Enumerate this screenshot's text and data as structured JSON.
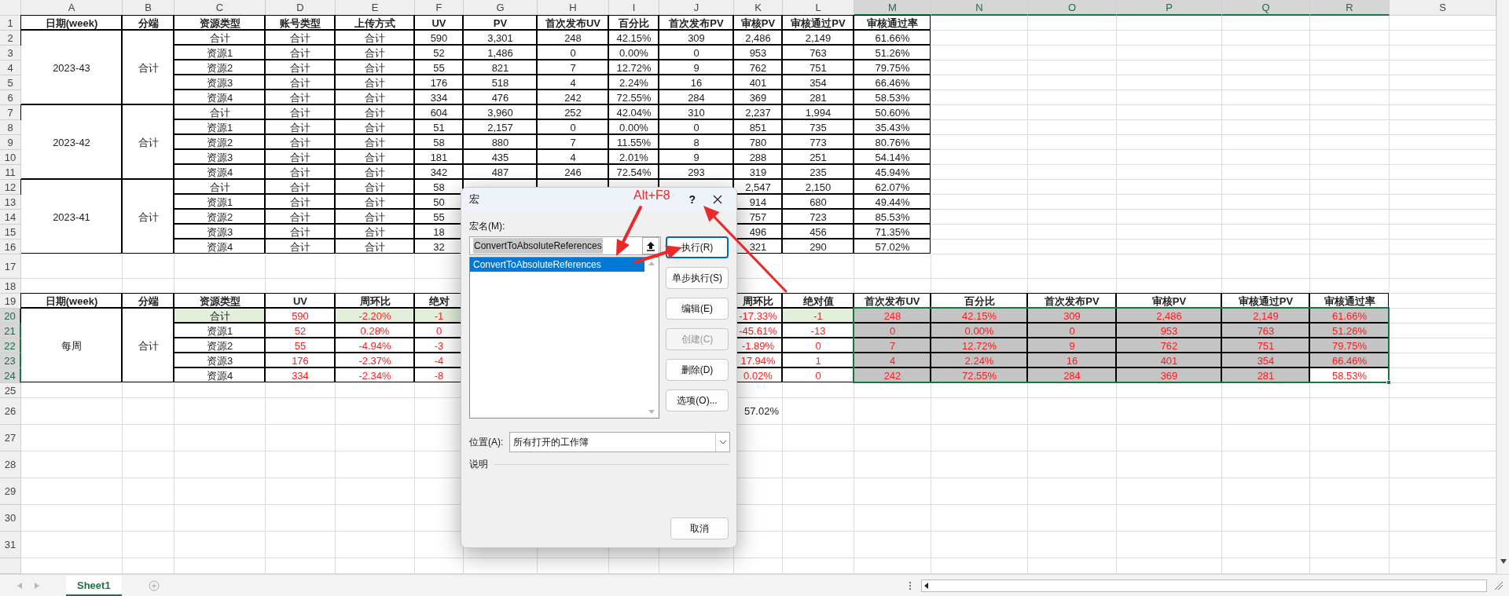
{
  "sheet": {
    "columns": [
      {
        "label": "A",
        "selected": false
      },
      {
        "label": "B",
        "selected": false
      },
      {
        "label": "C",
        "selected": false
      },
      {
        "label": "D",
        "selected": false
      },
      {
        "label": "E",
        "selected": false
      },
      {
        "label": "F",
        "selected": false
      },
      {
        "label": "G",
        "selected": false
      },
      {
        "label": "H",
        "selected": false
      },
      {
        "label": "I",
        "selected": false
      },
      {
        "label": "J",
        "selected": false
      },
      {
        "label": "K",
        "selected": false
      },
      {
        "label": "L",
        "selected": false
      },
      {
        "label": "M",
        "selected": true
      },
      {
        "label": "N",
        "selected": true
      },
      {
        "label": "O",
        "selected": true
      },
      {
        "label": "P",
        "selected": true
      },
      {
        "label": "Q",
        "selected": true
      },
      {
        "label": "R",
        "selected": true
      },
      {
        "label": "S",
        "selected": false
      }
    ],
    "rows": [
      {
        "label": "1",
        "selected": false
      },
      {
        "label": "2",
        "selected": false
      },
      {
        "label": "3",
        "selected": false
      },
      {
        "label": "4",
        "selected": false
      },
      {
        "label": "5",
        "selected": false
      },
      {
        "label": "6",
        "selected": false
      },
      {
        "label": "7",
        "selected": false
      },
      {
        "label": "8",
        "selected": false
      },
      {
        "label": "9",
        "selected": false
      },
      {
        "label": "10",
        "selected": false
      },
      {
        "label": "11",
        "selected": false
      },
      {
        "label": "12",
        "selected": false
      },
      {
        "label": "13",
        "selected": false
      },
      {
        "label": "14",
        "selected": false
      },
      {
        "label": "15",
        "selected": false
      },
      {
        "label": "16",
        "selected": false
      },
      {
        "label": "17",
        "selected": false
      },
      {
        "label": "18",
        "selected": false
      },
      {
        "label": "19",
        "selected": false
      },
      {
        "label": "20",
        "selected": true
      },
      {
        "label": "21",
        "selected": true
      },
      {
        "label": "22",
        "selected": true
      },
      {
        "label": "23",
        "selected": true
      },
      {
        "label": "24",
        "selected": true
      },
      {
        "label": "25",
        "selected": false
      },
      {
        "label": "26",
        "selected": false,
        "cells_after_dialog": [
          "57.02%"
        ]
      },
      {
        "label": "27",
        "selected": false
      },
      {
        "label": "28",
        "selected": false
      },
      {
        "label": "29",
        "selected": false
      },
      {
        "label": "30",
        "selected": false
      },
      {
        "label": "31",
        "selected": false
      }
    ],
    "top_table": {
      "header": [
        "日期(week)",
        "分端",
        "资源类型",
        "账号类型",
        "上传方式",
        "UV",
        "PV",
        "首次发布UV",
        "百分比",
        "首次发布PV",
        "审核PV",
        "审核通过PV",
        "审核通过率"
      ],
      "groups": [
        {
          "kind": "plain",
          "week": "2023-43",
          "platform": "合计",
          "rows": [
            {
              "cells": [
                "合计",
                "合计",
                "合计",
                "590",
                "3,301",
                "248",
                "42.15%",
                "309",
                "2,486",
                "2,149",
                "61.66%"
              ]
            },
            {
              "cells": [
                "资源1",
                "合计",
                "合计",
                "52",
                "1,486",
                "0",
                "0.00%",
                "0",
                "953",
                "763",
                "51.26%"
              ]
            },
            {
              "cells": [
                "资源2",
                "合计",
                "合计",
                "55",
                "821",
                "7",
                "12.72%",
                "9",
                "762",
                "751",
                "79.75%"
              ]
            },
            {
              "cells": [
                "资源3",
                "合计",
                "合计",
                "176",
                "518",
                "4",
                "2.24%",
                "16",
                "401",
                "354",
                "66.46%"
              ]
            },
            {
              "cells": [
                "资源4",
                "合计",
                "合计",
                "334",
                "476",
                "242",
                "72.55%",
                "284",
                "369",
                "281",
                "58.53%"
              ]
            }
          ]
        },
        {
          "kind": "plain",
          "week": "2023-42",
          "platform": "合计",
          "rows": [
            {
              "cells": [
                "合计",
                "合计",
                "合计",
                "604",
                "3,960",
                "252",
                "42.04%",
                "310",
                "2,237",
                "1,994",
                "50.60%"
              ]
            },
            {
              "cells": [
                "资源1",
                "合计",
                "合计",
                "51",
                "2,157",
                "0",
                "0.00%",
                "0",
                "851",
                "735",
                "35.43%"
              ]
            },
            {
              "cells": [
                "资源2",
                "合计",
                "合计",
                "58",
                "880",
                "7",
                "11.55%",
                "8",
                "780",
                "773",
                "80.76%"
              ]
            },
            {
              "cells": [
                "资源3",
                "合计",
                "合计",
                "181",
                "435",
                "4",
                "2.01%",
                "9",
                "288",
                "251",
                "54.14%"
              ]
            },
            {
              "cells": [
                "资源4",
                "合计",
                "合计",
                "342",
                "487",
                "246",
                "72.54%",
                "293",
                "319",
                "235",
                "45.94%"
              ]
            }
          ]
        },
        {
          "kind": "plain",
          "week": "2023-41",
          "platform": "合计",
          "rows": [
            {
              "cells": [
                "合计",
                "合计",
                "合计",
                "58"
              ],
              "cells_after_dialog": [
                "2,547",
                "2,150",
                "62.07%"
              ]
            },
            {
              "cells": [
                "资源1",
                "合计",
                "合计",
                "50"
              ],
              "cells_after_dialog": [
                "914",
                "680",
                "49.44%"
              ]
            },
            {
              "cells": [
                "资源2",
                "合计",
                "合计",
                "55"
              ],
              "cells_after_dialog": [
                "757",
                "723",
                "85.53%"
              ]
            },
            {
              "cells": [
                "资源3",
                "合计",
                "合计",
                "18"
              ],
              "cells_after_dialog": [
                "496",
                "456",
                "71.35%"
              ]
            },
            {
              "cells": [
                "资源4",
                "合计",
                "合计",
                "32"
              ],
              "cells_after_dialog": [
                "321",
                "290",
                "57.02%"
              ]
            }
          ]
        }
      ]
    },
    "bottom_table": {
      "header": [
        "日期(week)",
        "分端",
        "资源类型",
        "UV",
        "周环比",
        "绝对"
      ],
      "header_after_dialog": [
        "周环比",
        "绝对值",
        "首次发布UV",
        "百分比",
        "首次发布PV",
        "审核PV",
        "审核通过PV",
        "审核通过率"
      ],
      "groups": [
        {
          "kind": "summary",
          "week": "每周",
          "platform": "合计",
          "rows": [
            {
              "cells": [
                {
                  "text": "合计",
                  "highlighted": true,
                  "selected": false
                },
                {
                  "text": "590",
                  "highlighted": false,
                  "selected": false
                },
                {
                  "text": "-2.20%",
                  "highlighted": true,
                  "selected": false
                },
                {
                  "text": "-1",
                  "highlighted": true,
                  "selected": false
                }
              ],
              "cells_after_dialog": [
                {
                  "text": "-17.33%",
                  "highlighted": false,
                  "selected": false
                },
                {
                  "text": "-1",
                  "highlighted": true,
                  "selected": false
                },
                {
                  "text": "248",
                  "highlighted": false,
                  "selected": true
                },
                {
                  "text": "42.15%",
                  "highlighted": false,
                  "selected": true
                },
                {
                  "text": "309",
                  "highlighted": false,
                  "selected": true
                },
                {
                  "text": "2,486",
                  "highlighted": false,
                  "selected": true
                },
                {
                  "text": "2,149",
                  "highlighted": false,
                  "selected": true
                },
                {
                  "text": "61.66%",
                  "highlighted": false,
                  "selected": true
                }
              ]
            },
            {
              "cells": [
                {
                  "text": "资源1",
                  "highlighted": false,
                  "selected": false
                },
                {
                  "text": "52",
                  "highlighted": false,
                  "selected": false
                },
                {
                  "text": "0.28%",
                  "highlighted": false,
                  "selected": false
                },
                {
                  "text": "0",
                  "highlighted": false,
                  "selected": false
                }
              ],
              "cells_after_dialog": [
                {
                  "text": "-45.61%",
                  "highlighted": false,
                  "selected": false
                },
                {
                  "text": "-13",
                  "highlighted": false,
                  "selected": false
                },
                {
                  "text": "0",
                  "highlighted": false,
                  "selected": true
                },
                {
                  "text": "0.00%",
                  "highlighted": false,
                  "selected": true
                },
                {
                  "text": "0",
                  "highlighted": false,
                  "selected": true
                },
                {
                  "text": "953",
                  "highlighted": false,
                  "selected": true
                },
                {
                  "text": "763",
                  "highlighted": false,
                  "selected": true
                },
                {
                  "text": "51.26%",
                  "highlighted": false,
                  "selected": true
                }
              ]
            },
            {
              "cells": [
                {
                  "text": "资源2",
                  "highlighted": false,
                  "selected": false
                },
                {
                  "text": "55",
                  "highlighted": false,
                  "selected": false
                },
                {
                  "text": "-4.94%",
                  "highlighted": false,
                  "selected": false
                },
                {
                  "text": "-3",
                  "highlighted": false,
                  "selected": false
                }
              ],
              "cells_after_dialog": [
                {
                  "text": "-1.89%",
                  "highlighted": false,
                  "selected": false
                },
                {
                  "text": "0",
                  "highlighted": false,
                  "selected": false
                },
                {
                  "text": "7",
                  "highlighted": false,
                  "selected": true
                },
                {
                  "text": "12.72%",
                  "highlighted": false,
                  "selected": true
                },
                {
                  "text": "9",
                  "highlighted": false,
                  "selected": true
                },
                {
                  "text": "762",
                  "highlighted": false,
                  "selected": true
                },
                {
                  "text": "751",
                  "highlighted": false,
                  "selected": true
                },
                {
                  "text": "79.75%",
                  "highlighted": false,
                  "selected": true
                }
              ]
            },
            {
              "cells": [
                {
                  "text": "资源3",
                  "highlighted": false,
                  "selected": false
                },
                {
                  "text": "176",
                  "highlighted": false,
                  "selected": false
                },
                {
                  "text": "-2.37%",
                  "highlighted": false,
                  "selected": false
                },
                {
                  "text": "-4",
                  "highlighted": false,
                  "selected": false
                }
              ],
              "cells_after_dialog": [
                {
                  "text": "17.94%",
                  "highlighted": false,
                  "selected": false
                },
                {
                  "text": "1",
                  "highlighted": false,
                  "selected": false
                },
                {
                  "text": "4",
                  "highlighted": false,
                  "selected": true
                },
                {
                  "text": "2.24%",
                  "highlighted": false,
                  "selected": true
                },
                {
                  "text": "16",
                  "highlighted": false,
                  "selected": true
                },
                {
                  "text": "401",
                  "highlighted": false,
                  "selected": true
                },
                {
                  "text": "354",
                  "highlighted": false,
                  "selected": true
                },
                {
                  "text": "66.46%",
                  "highlighted": false,
                  "selected": true
                }
              ]
            },
            {
              "cells": [
                {
                  "text": "资源4",
                  "highlighted": false,
                  "selected": false
                },
                {
                  "text": "334",
                  "highlighted": false,
                  "selected": false
                },
                {
                  "text": "-2.34%",
                  "highlighted": false,
                  "selected": false
                },
                {
                  "text": "-8",
                  "highlighted": false,
                  "selected": false
                }
              ],
              "cells_after_dialog": [
                {
                  "text": "0.02%",
                  "highlighted": false,
                  "selected": false
                },
                {
                  "text": "0",
                  "highlighted": false,
                  "selected": false
                },
                {
                  "text": "242",
                  "highlighted": false,
                  "selected": true
                },
                {
                  "text": "72.55%",
                  "highlighted": false,
                  "selected": true
                },
                {
                  "text": "284",
                  "highlighted": false,
                  "selected": true
                },
                {
                  "text": "369",
                  "highlighted": false,
                  "selected": true
                },
                {
                  "text": "281",
                  "highlighted": false,
                  "selected": true
                },
                {
                  "text": "58.53%",
                  "highlighted": false,
                  "selected": false
                }
              ]
            }
          ]
        }
      ]
    }
  },
  "dialog": {
    "title": "宏",
    "help": "?",
    "name_label": "宏名(M):",
    "name_value": "ConvertToAbsoluteReferences",
    "macros": [
      {
        "label": "ConvertToAbsoluteReferences",
        "selected": true
      }
    ],
    "buttons": [
      {
        "label": "执行(R)",
        "default": true,
        "disabled": false
      },
      {
        "label": "单步执行(S)",
        "default": false,
        "disabled": false
      },
      {
        "label": "编辑(E)",
        "default": false,
        "disabled": false
      },
      {
        "label": "创建(C)",
        "default": false,
        "disabled": true
      },
      {
        "label": "删除(D)",
        "default": false,
        "disabled": false
      },
      {
        "label": "选项(O)...",
        "default": false,
        "disabled": false
      }
    ],
    "location_label": "位置(A):",
    "location_value": "所有打开的工作簿",
    "description_label": "说明",
    "cancel": "取消"
  },
  "annotation": {
    "label": "Alt+F8"
  },
  "sheet_tabs": [
    {
      "label": "Sheet1",
      "selected": true
    }
  ]
}
